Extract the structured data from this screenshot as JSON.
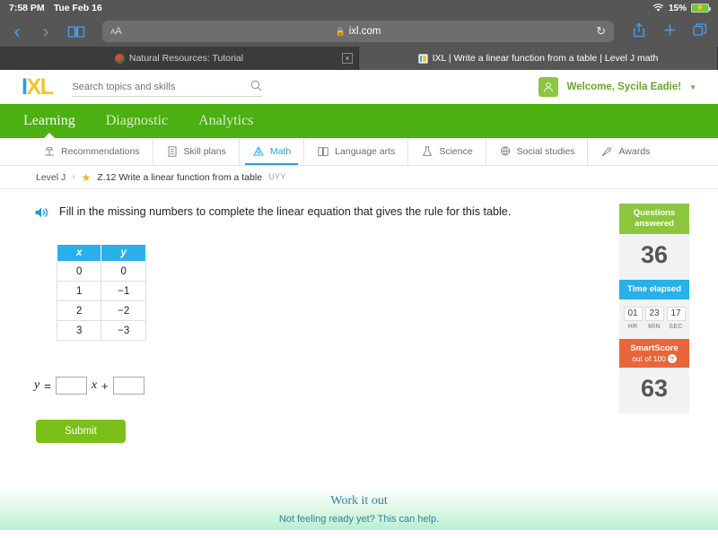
{
  "status_bar": {
    "time": "7:58 PM",
    "date": "Tue Feb 16",
    "battery_percent": "15%",
    "wifi_icon": "wifi-icon",
    "battery_icon": "battery-charging-icon"
  },
  "browser": {
    "back_icon": "chevron-left-icon",
    "forward_icon": "chevron-right-icon",
    "bookmarks_icon": "book-icon",
    "reader_label": "AA",
    "url": "ixl.com",
    "lock_icon": "lock-icon",
    "reload_icon": "reload-icon",
    "share_icon": "share-icon",
    "new_tab_icon": "plus-icon",
    "tabs_overview_icon": "tabs-icon",
    "tabs": [
      {
        "title": "Natural Resources: Tutorial",
        "active": false,
        "close_label": "×"
      },
      {
        "title": "IXL | Write a linear function from a table | Level J math",
        "active": true
      }
    ]
  },
  "header": {
    "logo_i": "I",
    "logo_xl": "XL",
    "search_placeholder": "Search topics and skills",
    "search_value": "",
    "search_icon": "search-icon",
    "avatar_icon": "user-avatar-icon",
    "welcome_text": "Welcome, Sycila Eadie!",
    "caret_icon": "chevron-down-icon"
  },
  "main_nav": [
    {
      "label": "Learning",
      "active": true
    },
    {
      "label": "Diagnostic",
      "active": false
    },
    {
      "label": "Analytics",
      "active": false
    }
  ],
  "sub_nav": [
    {
      "label": "Recommendations",
      "icon": "recommendations-icon",
      "active": false
    },
    {
      "label": "Skill plans",
      "icon": "skill-plans-icon",
      "active": false
    },
    {
      "label": "Math",
      "icon": "math-icon",
      "active": true
    },
    {
      "label": "Language arts",
      "icon": "language-arts-icon",
      "active": false
    },
    {
      "label": "Science",
      "icon": "science-icon",
      "active": false
    },
    {
      "label": "Social studies",
      "icon": "social-studies-icon",
      "active": false
    },
    {
      "label": "Awards",
      "icon": "awards-icon",
      "active": false
    }
  ],
  "breadcrumb": {
    "level": "Level J",
    "separator": "›",
    "star_icon": "star-icon",
    "skill_title": "Z.12 Write a linear function from a table",
    "skill_code": "UYY"
  },
  "question": {
    "speaker_icon": "speaker-icon",
    "text": "Fill in the missing numbers to complete the linear equation that gives the rule for this table.",
    "table": {
      "headers": [
        "x",
        "y"
      ],
      "rows": [
        [
          "0",
          "0"
        ],
        [
          "1",
          "−1"
        ],
        [
          "2",
          "−2"
        ],
        [
          "3",
          "−3"
        ]
      ]
    },
    "equation": {
      "lhs": "y",
      "equals": "=",
      "slope_value": "",
      "variable": "x",
      "plus": "+",
      "intercept_value": ""
    },
    "submit_label": "Submit"
  },
  "stats": {
    "questions": {
      "title": "Questions answered",
      "value": "36"
    },
    "time": {
      "title": "Time elapsed",
      "hours": "01",
      "minutes": "23",
      "seconds": "17",
      "hr_label": "HR",
      "min_label": "MIN",
      "sec_label": "SEC"
    },
    "smartscore": {
      "title": "SmartScore",
      "subtitle": "out of 100",
      "help_icon": "help-icon",
      "help_label": "?",
      "value": "63"
    }
  },
  "workout": {
    "title": "Work it out",
    "subtitle": "Not feeling ready yet? This can help."
  },
  "colors": {
    "ixl_green": "#4caf12",
    "ixl_blue": "#29b0e8",
    "ixl_yellow": "#f4c430",
    "submit_green": "#7bc018",
    "smartscore_orange": "#e8663a",
    "questions_green": "#8cc63f"
  }
}
